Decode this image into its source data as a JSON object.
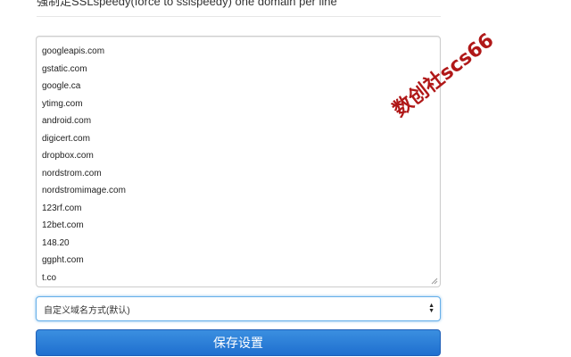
{
  "header": {
    "label": "强制走SSLspeedy(force to sslspeedy) one domain per line"
  },
  "domains": [
    "googleapis.com",
    "gstatic.com",
    "google.ca",
    "ytimg.com",
    "android.com",
    "digicert.com",
    "dropbox.com",
    "nordstrom.com",
    "nordstromimage.com",
    "123rf.com",
    "12bet.com",
    "148.20",
    "ggpht.com",
    "t.co"
  ],
  "mode_select": {
    "selected": "自定义域名方式(默认)"
  },
  "save_button": {
    "label": "保存设置"
  },
  "watermark": {
    "text": "数创社scs66"
  },
  "colors": {
    "button_primary": "#1f6fcf",
    "focus_border": "#66afe9",
    "watermark": "#b01818"
  },
  "icons": {
    "select_arrows": "up-down-chevron-icon",
    "resize": "resize-grip-icon"
  }
}
